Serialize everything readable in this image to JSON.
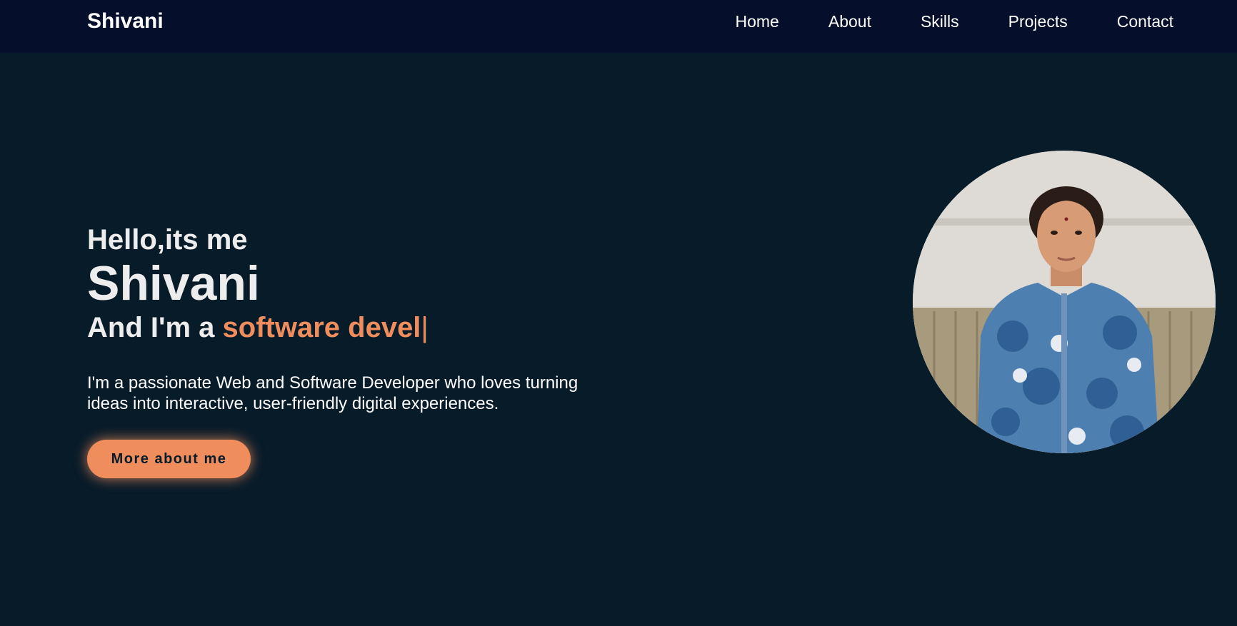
{
  "header": {
    "logo": "Shivani",
    "nav": [
      {
        "label": "Home"
      },
      {
        "label": "About"
      },
      {
        "label": "Skills"
      },
      {
        "label": "Projects"
      },
      {
        "label": "Contact"
      }
    ]
  },
  "hero": {
    "greeting": "Hello,its me",
    "name": "Shivani",
    "role_prefix": "And I'm a ",
    "role_typed": "software devel",
    "cursor": "|",
    "description": "I'm a passionate Web and Software Developer who loves turning ideas into interactive, user-friendly digital experiences.",
    "button_label": "More about me"
  },
  "colors": {
    "accent": "#ef8d5d",
    "background": "#081b29",
    "navbar": "#050f2b"
  }
}
